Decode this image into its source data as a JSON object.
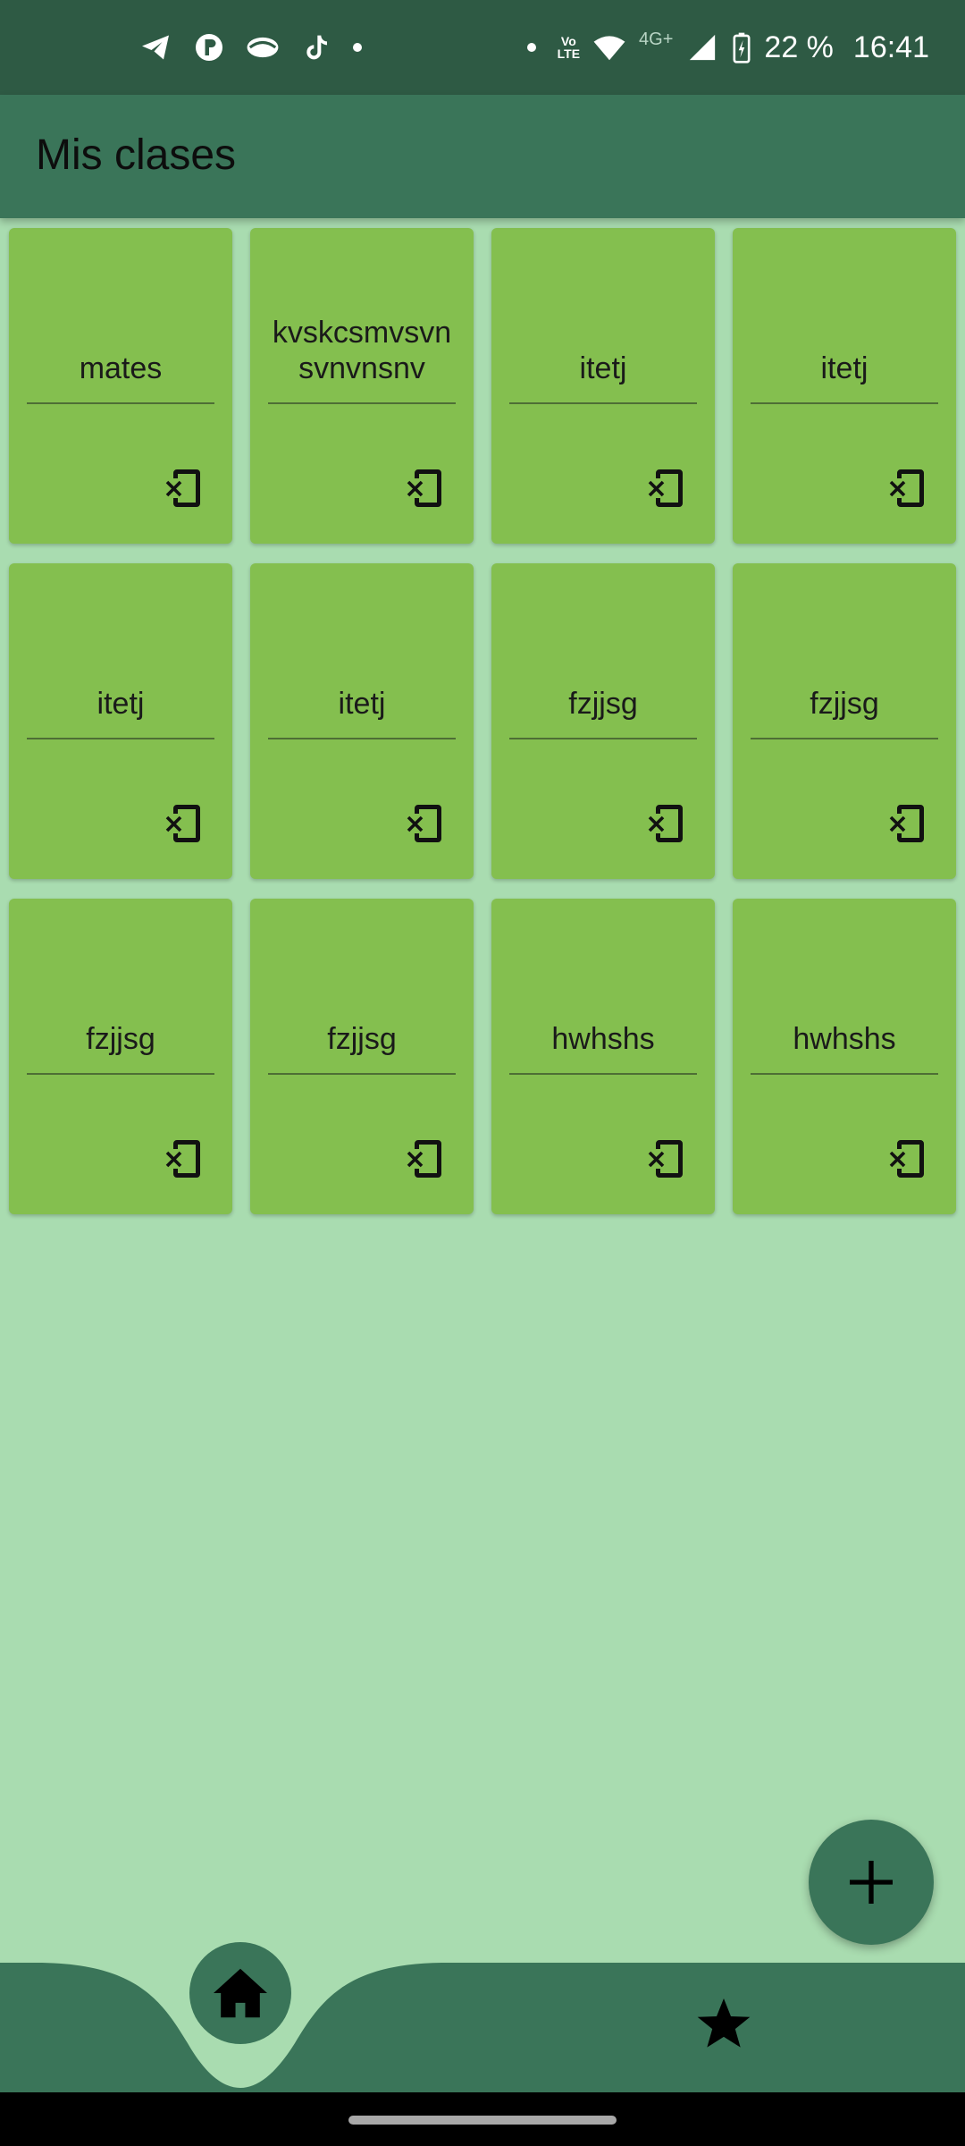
{
  "status_bar": {
    "volte_top": "Vo",
    "volte_bottom": "LTE",
    "network": "4G+",
    "battery": "22 %",
    "time": "16:41"
  },
  "app_bar": {
    "title": "Mis clases"
  },
  "classes": [
    {
      "name": "mates"
    },
    {
      "name": "kvskcsmvsvn svnvnsnv"
    },
    {
      "name": "itetj"
    },
    {
      "name": "itetj"
    },
    {
      "name": "itetj"
    },
    {
      "name": "itetj"
    },
    {
      "name": "fzjjsg"
    },
    {
      "name": "fzjjsg"
    },
    {
      "name": "fzjjsg"
    },
    {
      "name": "fzjjsg"
    },
    {
      "name": "hwhshs"
    },
    {
      "name": "hwhshs"
    }
  ],
  "colors": {
    "status_bar": "#2e5a44",
    "app_bar": "#3a7559",
    "background": "#a9dcb0",
    "card": "#84bf4f",
    "nav": "#3a7559"
  },
  "icons": {
    "card_action": "phonelink-erase-icon",
    "fab": "add-icon",
    "nav_home": "home-icon",
    "nav_star": "star-icon"
  }
}
